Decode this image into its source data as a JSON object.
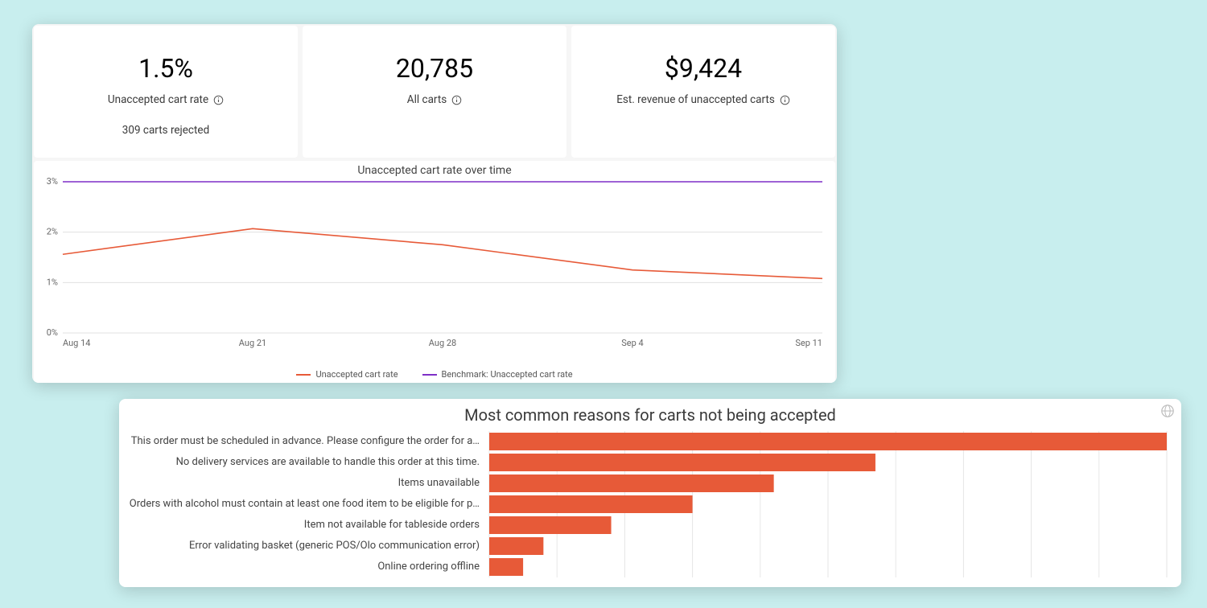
{
  "kpis": [
    {
      "value": "1.5%",
      "label": "Unaccepted cart rate",
      "sub": "309 carts rejected"
    },
    {
      "value": "20,785",
      "label": "All carts",
      "sub": ""
    },
    {
      "value": "$9,424",
      "label": "Est. revenue of unaccepted carts",
      "sub": ""
    }
  ],
  "line_chart_title": "Unaccepted cart rate over time",
  "legend": {
    "series1": "Unaccepted cart rate",
    "series2": "Benchmark: Unaccepted cart rate"
  },
  "reasons_title": "Most common reasons for carts not being accepted",
  "chart_data": [
    {
      "type": "line",
      "title": "Unaccepted cart rate over time",
      "xlabel": "",
      "ylabel": "",
      "ylim": [
        0,
        3
      ],
      "yticks": [
        0,
        1,
        2,
        3
      ],
      "yformat": "percent",
      "categories": [
        "Aug 14",
        "Aug 21",
        "Aug 28",
        "Sep 4",
        "Sep 11"
      ],
      "series": [
        {
          "name": "Unaccepted cart rate",
          "color": "#e75a38",
          "values": [
            1.56,
            2.07,
            1.75,
            1.25,
            1.08
          ]
        },
        {
          "name": "Benchmark: Unaccepted cart rate",
          "color": "#7e2fc7",
          "values": [
            3,
            3,
            3,
            3,
            3
          ]
        }
      ]
    },
    {
      "type": "bar",
      "orientation": "horizontal",
      "title": "Most common reasons for carts not being accepted",
      "xlim": [
        0,
        100
      ],
      "gridlines": 10,
      "categories": [
        "This order must be scheduled in advance. Please configure the order for a…",
        "No delivery services are available to handle this order at this time.",
        "Items unavailable",
        "Orders with alcohol must contain at least one food item to be eligible for p…",
        "Item not available for tableside orders",
        "Error validating basket (generic POS/Olo communication error)",
        "Online ordering offline"
      ],
      "values": [
        100,
        57,
        42,
        30,
        18,
        8,
        5
      ],
      "color": "#e75a38"
    }
  ]
}
